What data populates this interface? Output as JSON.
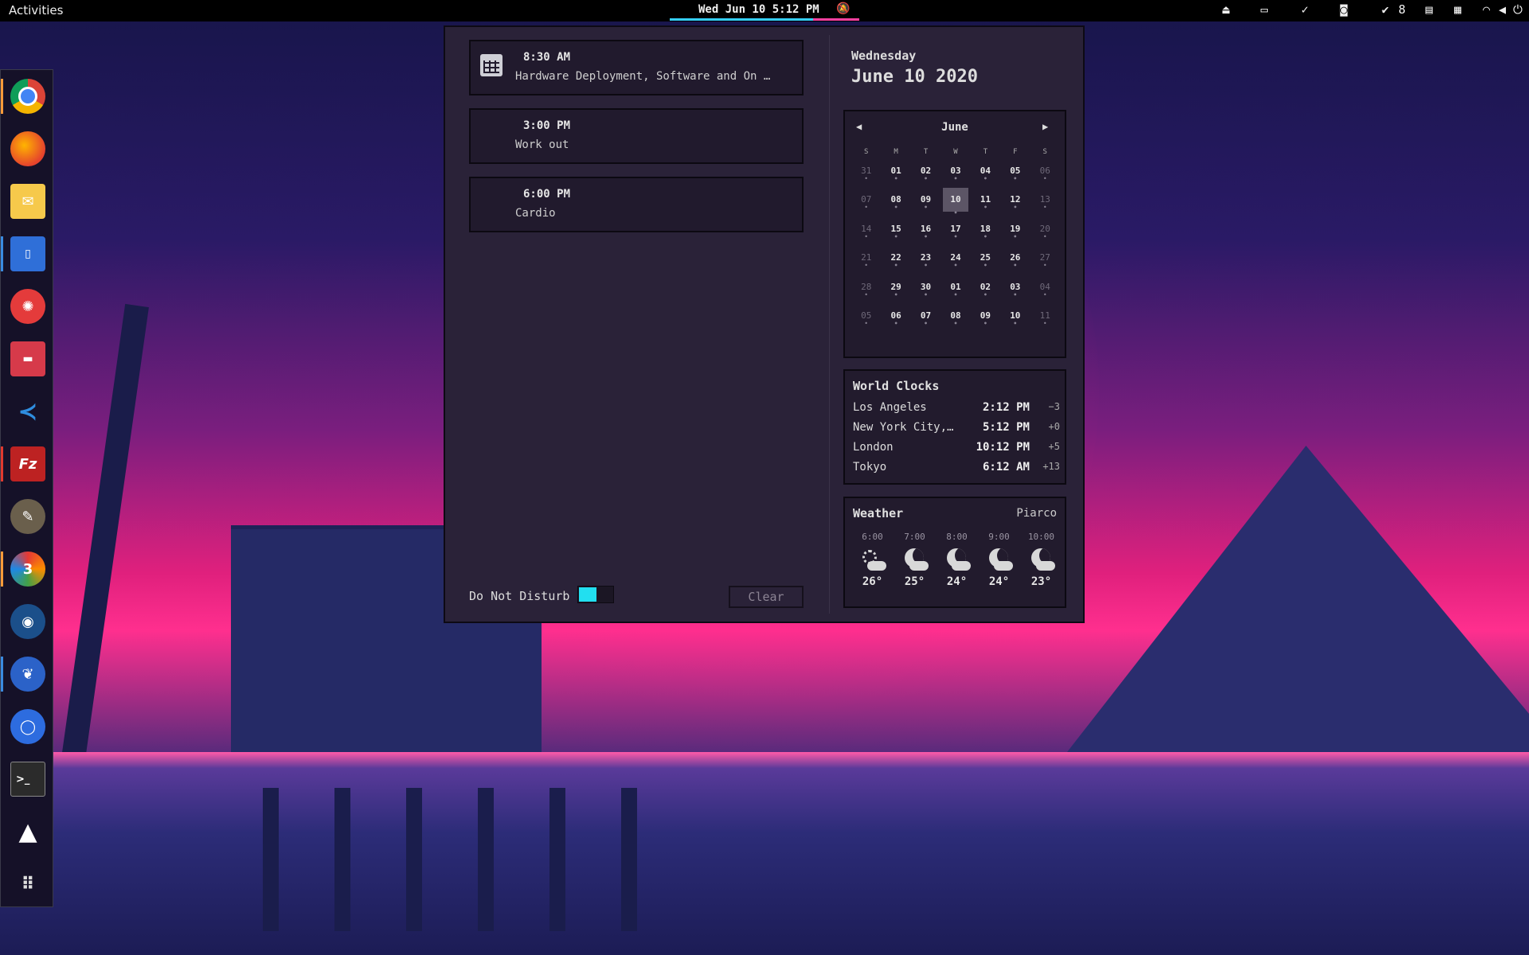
{
  "topbar": {
    "activities": "Activities",
    "datetime": "Wed Jun 10  5:12 PM",
    "notifications_icon": "bell-off-icon",
    "tray_count": "8",
    "tray_icons": [
      "eject-icon",
      "screen-icon",
      "check-circle-icon",
      "camera-icon",
      "check-icon",
      "clipboard-icon",
      "layout-icon",
      "wifi-icon",
      "volume-icon",
      "power-icon"
    ]
  },
  "dock": {
    "apps": [
      "chrome",
      "firefox",
      "mail",
      "text-editor",
      "flare",
      "cassette",
      "vscode",
      "filezilla",
      "gimp",
      "blender-3",
      "steam",
      "cockatrice",
      "signal",
      "terminal",
      "inkscape",
      "app-grid"
    ]
  },
  "events": [
    {
      "time": "8:30 AM",
      "desc": "Hardware Deployment, Software and On …"
    },
    {
      "time": "3:00 PM",
      "desc": "Work out"
    },
    {
      "time": "6:00 PM",
      "desc": "Cardio"
    }
  ],
  "dnd": {
    "label": "Do Not Disturb",
    "enabled": true
  },
  "clear_label": "Clear",
  "date": {
    "weekday": "Wednesday",
    "full": "June 10 2020"
  },
  "calendar": {
    "month": "June",
    "weekdays": [
      "S",
      "M",
      "T",
      "W",
      "T",
      "F",
      "S"
    ],
    "weeks": [
      [
        "31",
        "01",
        "02",
        "03",
        "04",
        "05",
        "06"
      ],
      [
        "07",
        "08",
        "09",
        "10",
        "11",
        "12",
        "13"
      ],
      [
        "14",
        "15",
        "16",
        "17",
        "18",
        "19",
        "20"
      ],
      [
        "21",
        "22",
        "23",
        "24",
        "25",
        "26",
        "27"
      ],
      [
        "28",
        "29",
        "30",
        "01",
        "02",
        "03",
        "04"
      ],
      [
        "05",
        "06",
        "07",
        "08",
        "09",
        "10",
        "11"
      ]
    ],
    "today": "10"
  },
  "world_clocks": {
    "title": "World Clocks",
    "rows": [
      {
        "city": "Los Angeles",
        "time": "2:12 PM",
        "offset": "−3"
      },
      {
        "city": "New York City,…",
        "time": "5:12 PM",
        "offset": "+0"
      },
      {
        "city": "London",
        "time": "10:12 PM",
        "offset": "+5"
      },
      {
        "city": "Tokyo",
        "time": "6:12 AM",
        "offset": "+13"
      }
    ]
  },
  "weather": {
    "title": "Weather",
    "location": "Piarco",
    "hours": [
      {
        "hour": "6:00",
        "temp": "26°",
        "icon": "sun-cloud-icon"
      },
      {
        "hour": "7:00",
        "temp": "25°",
        "icon": "moon-cloud-icon"
      },
      {
        "hour": "8:00",
        "temp": "24°",
        "icon": "moon-cloud-icon"
      },
      {
        "hour": "9:00",
        "temp": "24°",
        "icon": "moon-cloud-icon"
      },
      {
        "hour": "10:00",
        "temp": "23°",
        "icon": "moon-cloud-icon"
      }
    ]
  },
  "colors": {
    "accent_pink": "#ff40a0",
    "accent_cyan": "#22dff0",
    "panel_bg": "#2a2238"
  }
}
